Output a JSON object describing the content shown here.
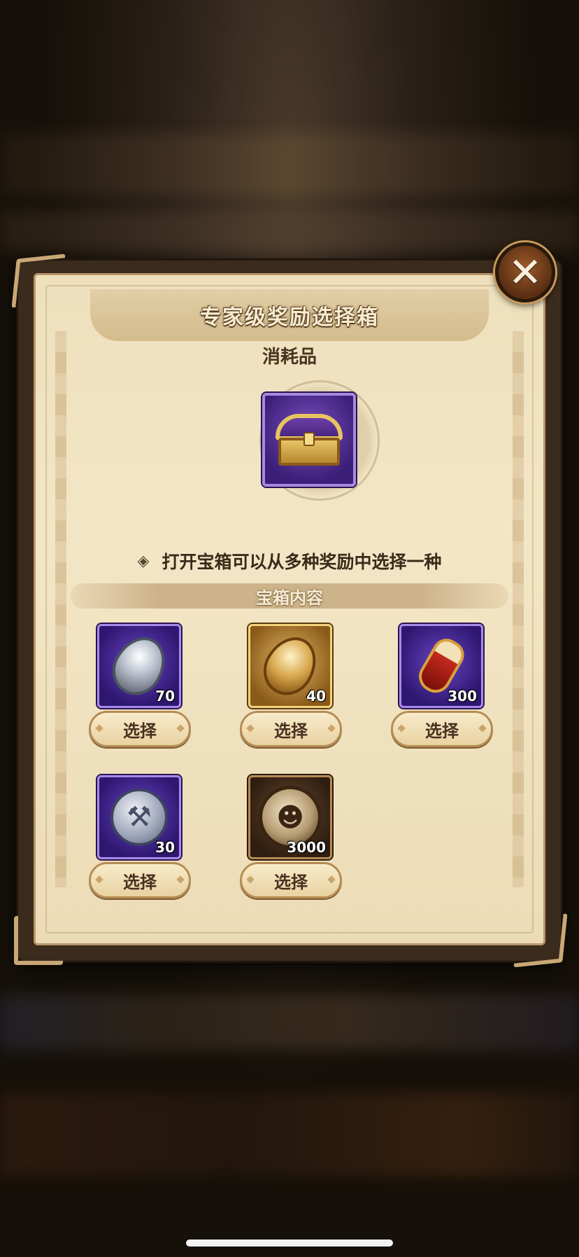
{
  "dialog": {
    "title": "专家级奖励选择箱",
    "subtitle": "消耗品",
    "description": "打开宝箱可以从多种奖励中选择一种",
    "section_title": "宝箱内容",
    "close_icon": "close-icon"
  },
  "items": [
    {
      "icon": "silver-stone-icon",
      "quantity": "70",
      "button": "选择"
    },
    {
      "icon": "gold-stone-icon",
      "quantity": "40",
      "button": "选择"
    },
    {
      "icon": "potion-icon",
      "quantity": "300",
      "button": "选择"
    },
    {
      "icon": "hammer-coin-icon",
      "quantity": "30",
      "button": "选择"
    },
    {
      "icon": "medal-icon",
      "quantity": "3000",
      "button": "选择"
    }
  ],
  "colors": {
    "panel": "#f3e6c6",
    "frame_purple": "#6a45c4",
    "frame_gold": "#e3b766",
    "text_dark": "#3a2a1a"
  }
}
